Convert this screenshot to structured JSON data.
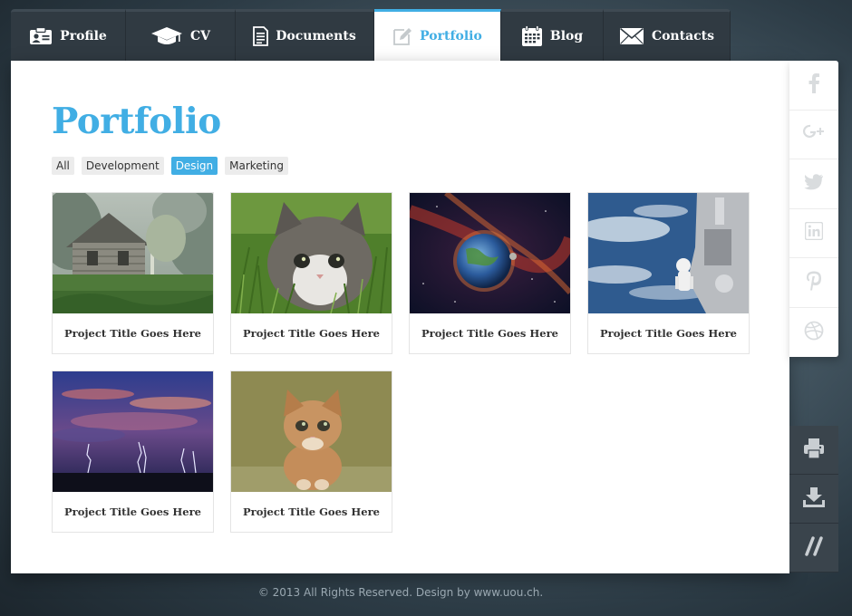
{
  "tabs": [
    {
      "label": "Profile",
      "icon": "id-card-icon"
    },
    {
      "label": "CV",
      "icon": "graduation-cap-icon"
    },
    {
      "label": "Documents",
      "icon": "document-icon"
    },
    {
      "label": "Portfolio",
      "icon": "pencil-edit-icon",
      "active": true
    },
    {
      "label": "Blog",
      "icon": "calendar-icon"
    },
    {
      "label": "Contacts",
      "icon": "envelope-icon"
    }
  ],
  "page": {
    "title": "Portfolio"
  },
  "filters": [
    {
      "label": "All"
    },
    {
      "label": "Development"
    },
    {
      "label": "Design",
      "active": true
    },
    {
      "label": "Marketing"
    }
  ],
  "portfolio": [
    {
      "title": "Project Title Goes Here",
      "image": "cabin-in-forest"
    },
    {
      "title": "Project Title Goes Here",
      "image": "kitten-in-grass"
    },
    {
      "title": "Project Title Goes Here",
      "image": "planet-in-space"
    },
    {
      "title": "Project Title Goes Here",
      "image": "astronaut-space-station"
    },
    {
      "title": "Project Title Goes Here",
      "image": "lightning-storm"
    },
    {
      "title": "Project Title Goes Here",
      "image": "sitting-kitten"
    }
  ],
  "social": [
    {
      "icon": "facebook-icon"
    },
    {
      "icon": "google-plus-icon"
    },
    {
      "icon": "twitter-icon"
    },
    {
      "icon": "linkedin-icon"
    },
    {
      "icon": "pinterest-icon"
    },
    {
      "icon": "dribbble-icon"
    }
  ],
  "actions": [
    {
      "icon": "print-icon"
    },
    {
      "icon": "download-icon"
    },
    {
      "icon": "slashes-icon"
    }
  ],
  "footer": {
    "text": "© 2013 All Rights Reserved. Design by www.uou.ch."
  },
  "colors": {
    "accent": "#41aee4",
    "tab_bg": "#303a42",
    "action_bg": "#3a444c"
  }
}
